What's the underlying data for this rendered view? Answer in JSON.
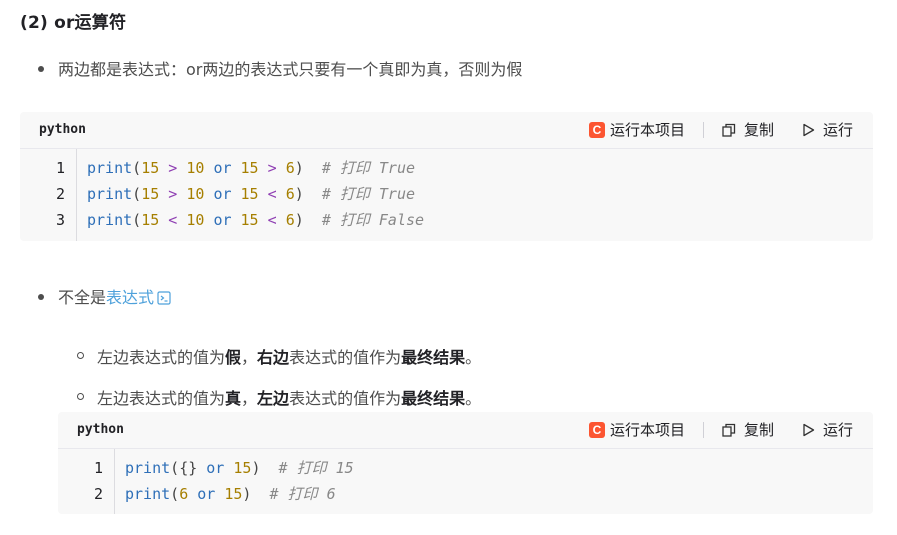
{
  "heading": "(2) or运算符",
  "bullet1": "两边都是表达式：or两边的表达式只要有一个真即为真，否则为假",
  "toolbar": {
    "run_project": "运行本项目",
    "copy": "复制",
    "run": "运行",
    "c_letter": "C"
  },
  "block1": {
    "lang": "python",
    "lines": [
      {
        "n": "1",
        "a": "15",
        "op1": ">",
        "b": "10",
        "or": "or",
        "c": "15",
        "op2": ">",
        "d": "6",
        "comment": "# 打印 True"
      },
      {
        "n": "2",
        "a": "15",
        "op1": ">",
        "b": "10",
        "or": "or",
        "c": "15",
        "op2": "<",
        "d": "6",
        "comment": "# 打印 True"
      },
      {
        "n": "3",
        "a": "15",
        "op1": "<",
        "b": "10",
        "or": "or",
        "c": "15",
        "op2": "<",
        "d": "6",
        "comment": "# 打印 False"
      }
    ],
    "fn": "print"
  },
  "bullet2": {
    "prefix": "不全是",
    "link": "表达式"
  },
  "sub1": {
    "t1": "左边表达式的值为",
    "b1": "假",
    "t2": "，",
    "b2": "右边",
    "t3": "表达式的值作为",
    "b3": "最终结果",
    "t4": "。"
  },
  "sub2": {
    "t1": "左边表达式的值为",
    "b1": "真",
    "t2": "，",
    "b2": "左边",
    "t3": "表达式的值作为",
    "b3": "最终结果",
    "t4": "。"
  },
  "block2": {
    "lang": "python",
    "fn": "print",
    "line1": {
      "n": "1",
      "arg": "{}",
      "or": "or",
      "num": "15",
      "comment": "# 打印 15"
    },
    "line2": {
      "n": "2",
      "arg": "6",
      "or": "or",
      "num": "15",
      "comment": "# 打印 6"
    }
  }
}
